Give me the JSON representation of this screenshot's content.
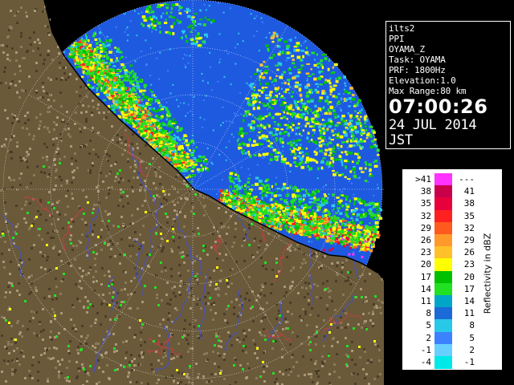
{
  "info": {
    "product": "ilts2",
    "scan_type": "PPI",
    "field": "OYAMA_Z",
    "task": "Task: OYAMA",
    "prf": "PRF: 1800Hz",
    "elevation": "Elevation:1.0",
    "max_range": "Max Range:80 km",
    "time": "07:00:26",
    "date": "24 JUL 2014 JST"
  },
  "legend": {
    "unit": "Reflectivity in dBZ",
    "rows": [
      {
        "lo": ">41",
        "hi": "---",
        "color": "#ff33ff"
      },
      {
        "lo": "38",
        "hi": "41",
        "color": "#c8004a"
      },
      {
        "lo": "35",
        "hi": "38",
        "color": "#e8003a"
      },
      {
        "lo": "32",
        "hi": "35",
        "color": "#ff2020"
      },
      {
        "lo": "29",
        "hi": "32",
        "color": "#ff5a1e"
      },
      {
        "lo": "26",
        "hi": "29",
        "color": "#ff9a2a"
      },
      {
        "lo": "23",
        "hi": "26",
        "color": "#ffc02a"
      },
      {
        "lo": "20",
        "hi": "23",
        "color": "#ffff00"
      },
      {
        "lo": "17",
        "hi": "20",
        "color": "#00c000"
      },
      {
        "lo": "14",
        "hi": "17",
        "color": "#22e022"
      },
      {
        "lo": "11",
        "hi": "14",
        "color": "#00a6c8"
      },
      {
        "lo": "8",
        "hi": "11",
        "color": "#1a6ad8"
      },
      {
        "lo": "5",
        "hi": "8",
        "color": "#28c8e8"
      },
      {
        "lo": "2",
        "hi": "5",
        "color": "#3c82ff"
      },
      {
        "lo": "-1",
        "hi": "2",
        "color": "#68d0ff"
      },
      {
        "lo": "-4",
        "hi": "-1",
        "color": "#00e8e8"
      }
    ]
  },
  "colors": {
    "sea_background": "#1e5ae0",
    "terrain": "#6a5a3a",
    "rivers": "#4050d0",
    "boundaries": "#c04040",
    "coastline": "#000000"
  }
}
